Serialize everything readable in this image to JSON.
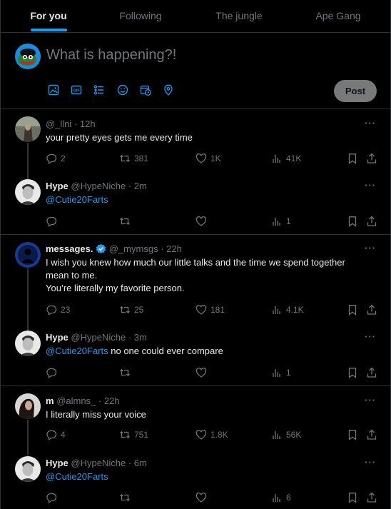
{
  "tabs": [
    {
      "label": "For you",
      "active": true
    },
    {
      "label": "Following",
      "active": false
    },
    {
      "label": "The jungle",
      "active": false
    },
    {
      "label": "Ape Gang",
      "active": false
    }
  ],
  "composer": {
    "placeholder": "What is happening?!",
    "post_label": "Post",
    "tools": [
      "image-icon",
      "gif-icon",
      "poll-icon",
      "emoji-icon",
      "schedule-icon",
      "location-icon"
    ]
  },
  "threads": [
    {
      "tweets": [
        {
          "name": "",
          "handle": "@_llni",
          "time": "· 12h",
          "text": "your pretty eyes gets me every time",
          "replies": "2",
          "retweets": "381",
          "likes": "1K",
          "views": "41K"
        },
        {
          "name": "Hype",
          "handle": "@HypeNiche",
          "time": "· 2m",
          "mention": "@Cutie20Farts",
          "text": "",
          "replies": "",
          "retweets": "",
          "likes": "",
          "views": "1"
        }
      ]
    },
    {
      "tweets": [
        {
          "name": "messages.",
          "verified": true,
          "handle": "@_mymsgs",
          "time": "· 22h",
          "text_lines": [
            "I wish you knew how much our little talks and the time we spend together",
            "mean to me.",
            "You’re literally my favorite person."
          ],
          "replies": "23",
          "retweets": "25",
          "likes": "181",
          "views": "4.1K"
        },
        {
          "name": "Hype",
          "handle": "@HypeNiche",
          "time": "· 3m",
          "mention": "@Cutie20Farts",
          "text": "no one could ever compare",
          "replies": "",
          "retweets": "",
          "likes": "",
          "views": "1"
        }
      ]
    },
    {
      "tweets": [
        {
          "name": "m",
          "handle": "@almns_",
          "time": "· 22h",
          "text": "I literally miss your voice",
          "replies": "4",
          "retweets": "751",
          "likes": "1.8K",
          "views": "56K"
        },
        {
          "name": "Hype",
          "handle": "@HypeNiche",
          "time": "· 6m",
          "mention": "@Cutie20Farts",
          "text": "",
          "replies": "",
          "retweets": "",
          "likes": "",
          "views": "6"
        }
      ]
    }
  ],
  "colors": {
    "accent": "#1d9bf0",
    "background": "#000000",
    "border": "#2f3336",
    "muted": "#71767b",
    "post_button": "#787a7a"
  }
}
